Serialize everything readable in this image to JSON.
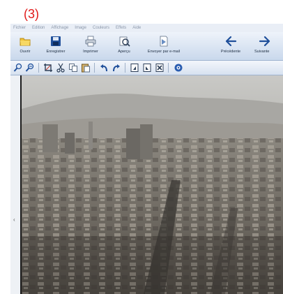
{
  "step_label": "(3)",
  "menu": [
    "Fichier",
    "Edition",
    "Affichage",
    "Image",
    "Couleurs",
    "Effets",
    "Aide"
  ],
  "toolbar": {
    "open": "Ouvrir",
    "save": "Enregistrer",
    "print": "Imprimer",
    "preview": "Aperçu",
    "email": "Envoyer par e-mail",
    "previous": "Précédente",
    "next": "Suivante"
  },
  "colors": {
    "step_label": "#e11a1a",
    "toolbar_bg": "#c9d8ec",
    "accent_blue": "#1f4f9a"
  }
}
